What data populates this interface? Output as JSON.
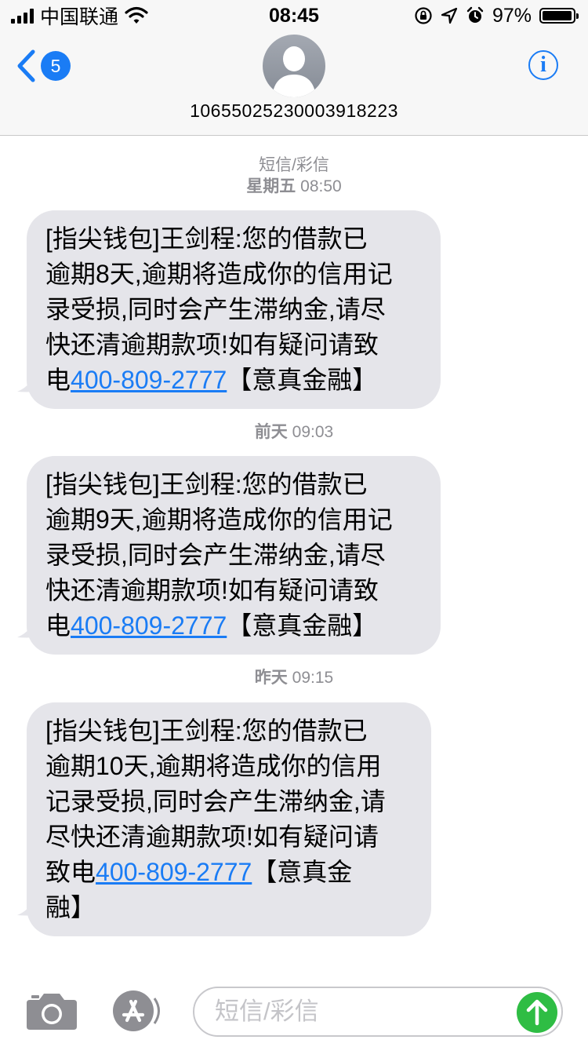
{
  "status_bar": {
    "carrier": "中国联通",
    "time": "08:45",
    "battery_percent": "97%",
    "battery_level": 0.97,
    "icons": [
      "signal-bars-icon",
      "wifi-icon",
      "orientation-lock-icon",
      "location-arrow-icon",
      "alarm-icon",
      "battery-icon"
    ]
  },
  "nav": {
    "back_badge": "5",
    "contact_number": "10655025230003918223",
    "info_symbol": "i"
  },
  "thread": {
    "header_type": "短信/彩信",
    "groups": [
      {
        "day": "星期五",
        "time": "08:50",
        "lines": [
          "[指尖钱包]王剑程:您的借款已",
          "逾期8天,逾期将造成你的信用记",
          "录受损,同时会产生滞纳金,请尽",
          "快还清逾期款项!如有疑问请致"
        ],
        "last_prefix": "电",
        "phone": "400-809-2777",
        "suffix": "【意真金融】",
        "extra": ""
      },
      {
        "day": "前天",
        "time": "09:03",
        "lines": [
          "[指尖钱包]王剑程:您的借款已",
          "逾期9天,逾期将造成你的信用记",
          "录受损,同时会产生滞纳金,请尽",
          "快还清逾期款项!如有疑问请致"
        ],
        "last_prefix": "电",
        "phone": "400-809-2777",
        "suffix": "【意真金融】",
        "extra": ""
      },
      {
        "day": "昨天",
        "time": "09:15",
        "lines": [
          "[指尖钱包]王剑程:您的借款已",
          "逾期10天,逾期将造成你的信用",
          "记录受损,同时会产生滞纳金,请",
          "尽快还清逾期款项!如有疑问请"
        ],
        "last_prefix": "致电",
        "phone": "400-809-2777",
        "suffix": "【意真金",
        "extra": "融】"
      }
    ]
  },
  "composer": {
    "placeholder": "短信/彩信",
    "icons": [
      "camera-icon",
      "app-store-icon",
      "send-arrow-icon"
    ]
  },
  "colors": {
    "accent": "#1a7cf5",
    "bubble": "#e5e5ea",
    "meta_text": "#8e8e93",
    "send": "#2fbd44"
  }
}
